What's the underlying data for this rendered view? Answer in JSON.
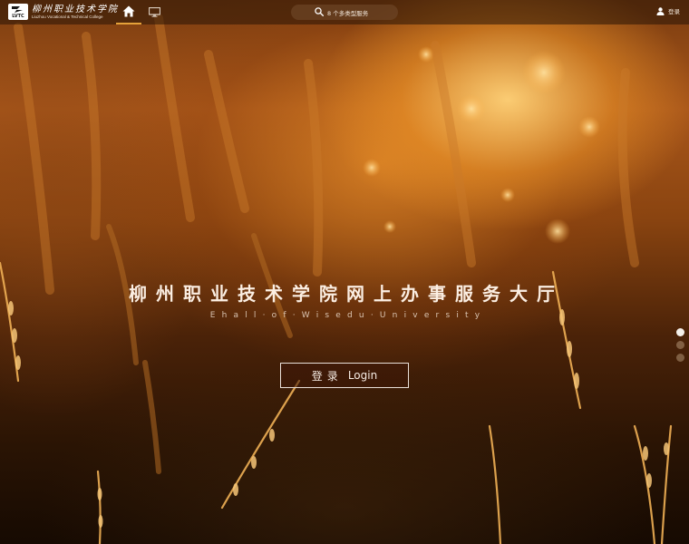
{
  "header": {
    "logo_badge": "LVTC",
    "logo_name_cn": "柳州职业技术学院",
    "logo_name_en": "Liuzhou Vocational & Technical College",
    "nav": [
      {
        "icon": "home-icon",
        "active": true
      },
      {
        "icon": "desktop-icon",
        "active": false
      }
    ],
    "search_placeholder": "8 个多类型服务",
    "user_label": "登录"
  },
  "hero": {
    "title": "柳州职业技术学院网上办事服务大厅",
    "subtitle": "Ehall·of·Wisedu·University",
    "login_cn": "登录",
    "login_en": "Login"
  },
  "carousel": {
    "slides": 3,
    "active_index": 0
  },
  "colors": {
    "accent": "#e4a13a",
    "topbar": "rgba(40,20,6,0.55)",
    "text_light": "#fbeee2"
  }
}
